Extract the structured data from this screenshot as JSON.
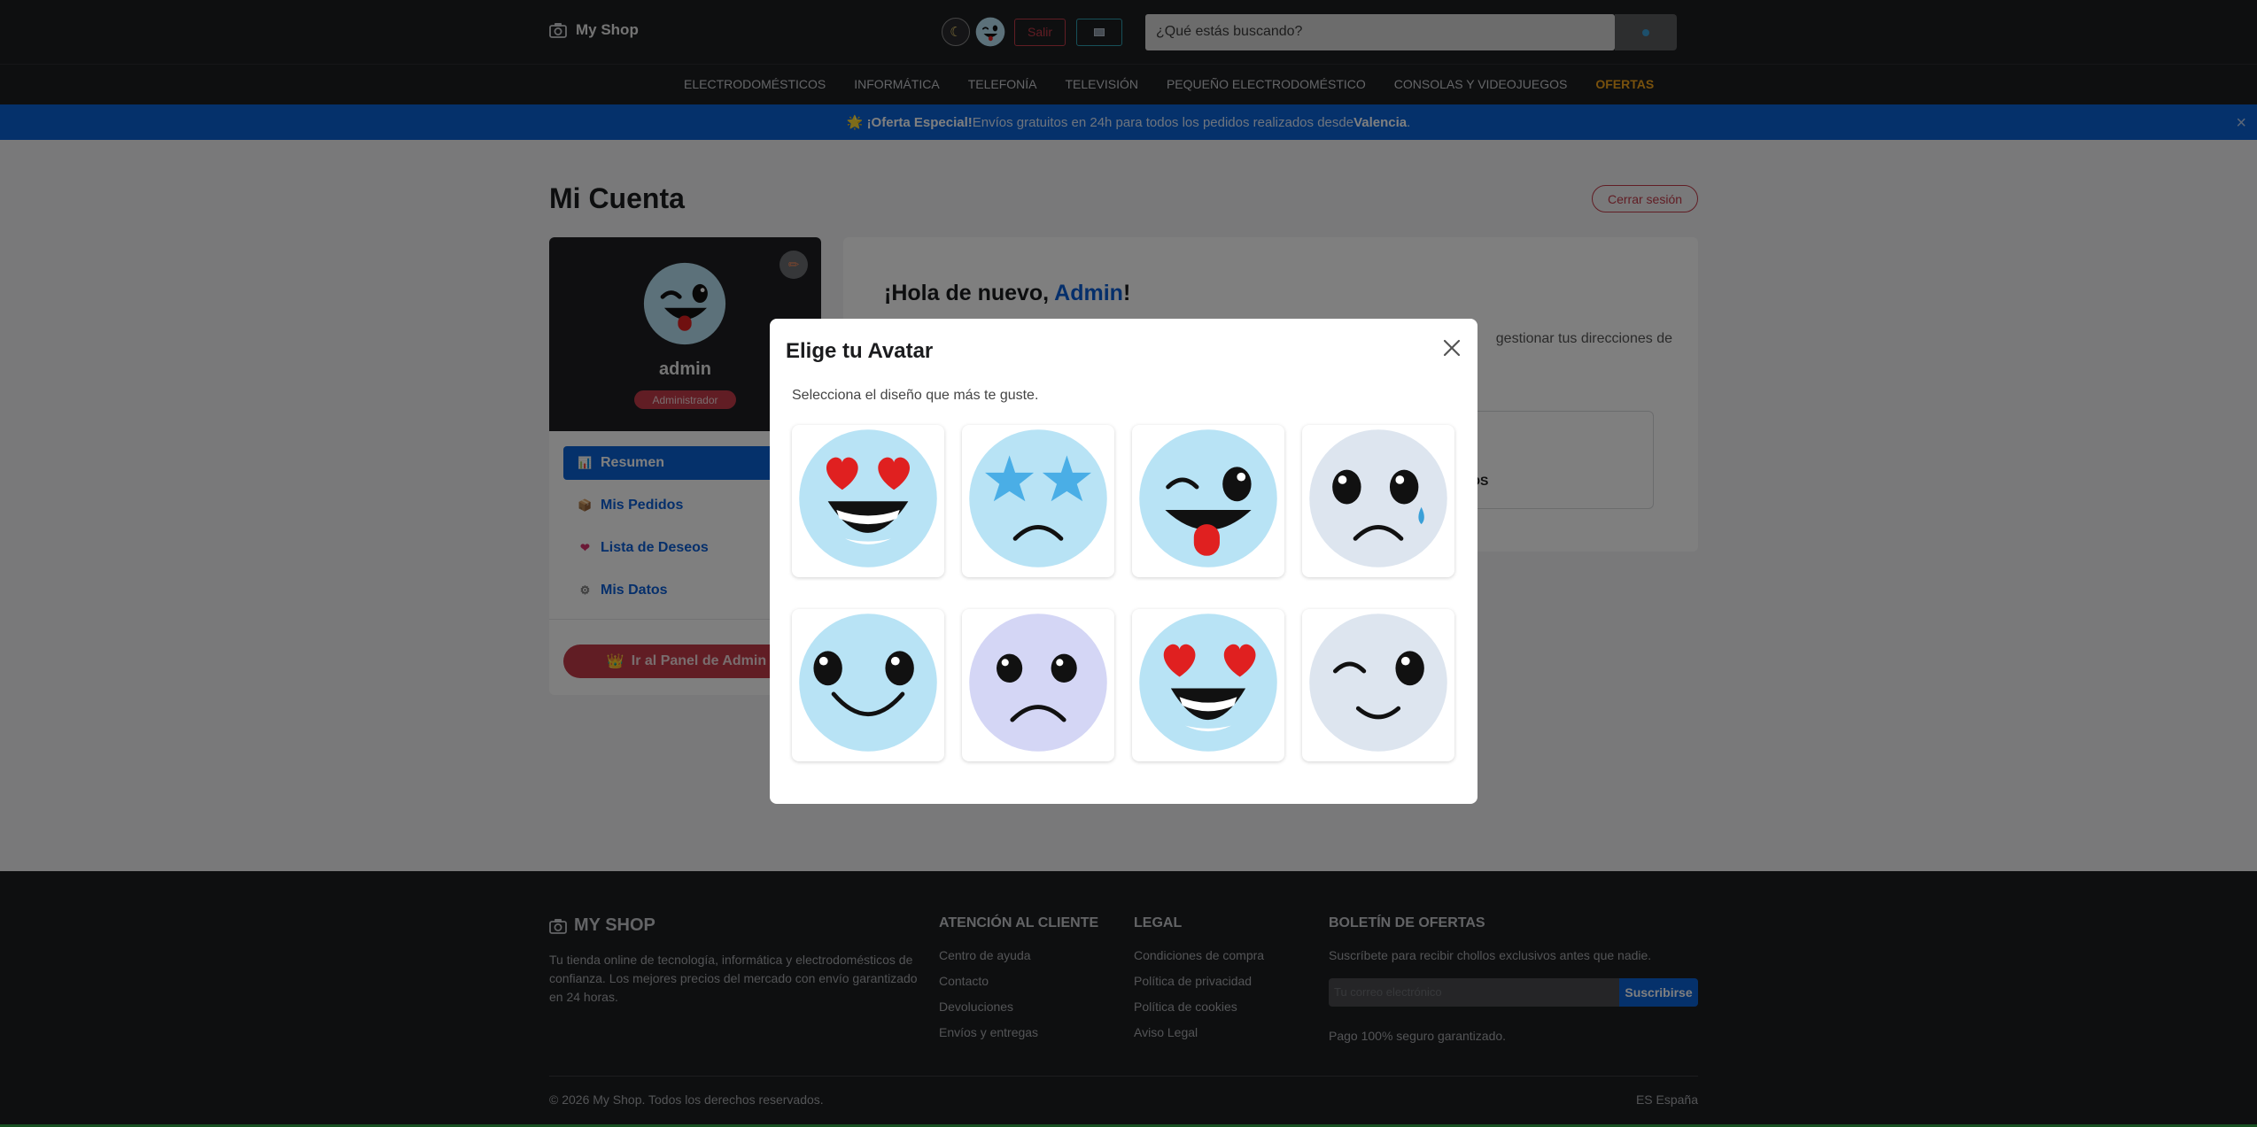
{
  "header": {
    "brand": "My Shop",
    "theme_icon": "☾",
    "logout_label": "Salir",
    "search_placeholder": "¿Qué estás buscando?"
  },
  "categories": [
    "ELECTRODOMÉSTICOS",
    "INFORMÁTICA",
    "TELEFONÍA",
    "TELEVISIÓN",
    "PEQUEÑO ELECTRODOMÉSTICO",
    "CONSOLAS Y VIDEOJUEGOS",
    "OFERTAS"
  ],
  "promo": {
    "icon": "🌟",
    "strong": "¡Oferta Especial!",
    "text": " Envíos gratuitos en 24h para todos los pedidos realizados desde ",
    "city": "Valencia",
    "end": ".",
    "close": "×"
  },
  "page": {
    "title": "Mi Cuenta",
    "logout_button": "Cerrar sesión"
  },
  "profile": {
    "username": "admin",
    "role": "Administrador",
    "edit_icon": "✏"
  },
  "menu": {
    "items": [
      {
        "icon": "📊",
        "label": "Resumen"
      },
      {
        "icon": "📦",
        "label": "Mis Pedidos"
      },
      {
        "icon": "❤",
        "label": "Lista de Deseos"
      },
      {
        "icon": "⚙",
        "label": "Mis Datos"
      }
    ],
    "admin_icon": "👑",
    "admin_button": "Ir al Panel de Admin"
  },
  "panel": {
    "greeting": "¡Hola de nuevo, ",
    "greeting_name": "Admin",
    "greeting_end": "!",
    "text_visible": "gestionar tus direcciones de",
    "card_label": "N DESEOS"
  },
  "modal": {
    "title": "Elige tu Avatar",
    "subtitle": "Selecciona el diseño que más te guste.",
    "avatars": [
      {
        "name": "heart-eyes-grin",
        "bg": "#b8e3f5"
      },
      {
        "name": "star-eyes-frown",
        "bg": "#b8e3f5"
      },
      {
        "name": "wink-tongue",
        "bg": "#b8e3f5"
      },
      {
        "name": "tear-frown",
        "bg": "#dde5ef"
      },
      {
        "name": "smile",
        "bg": "#b8e3f5"
      },
      {
        "name": "frown",
        "bg": "#d4d6f5"
      },
      {
        "name": "heart-eyes-grin",
        "bg": "#b8e3f5"
      },
      {
        "name": "wink-smile",
        "bg": "#dde5ef"
      }
    ]
  },
  "footer": {
    "brand": "MY SHOP",
    "description": "Tu tienda online de tecnología, informática y electrodomésticos de confianza. Los mejores precios del mercado con envío garantizado en 24 horas.",
    "support": {
      "title": "ATENCIÓN AL CLIENTE",
      "links": [
        "Centro de ayuda",
        "Contacto",
        "Devoluciones",
        "Envíos y entregas"
      ]
    },
    "legal": {
      "title": "LEGAL",
      "links": [
        "Condiciones de compra",
        "Política de privacidad",
        "Política de cookies",
        "Aviso Legal"
      ]
    },
    "newsletter": {
      "title": "BOLETÍN DE OFERTAS",
      "text": "Suscríbete para recibir chollos exclusivos antes que nadie.",
      "placeholder": "Tu correo electrónico",
      "button": "Suscribirse",
      "note": "Pago 100% seguro garantizado."
    },
    "copyright": "© 2026 My Shop. Todos los derechos reservados.",
    "language": "ES España"
  },
  "colors": {
    "primary": "#0b62d6",
    "danger": "#c23a48",
    "offer": "#f0a21a",
    "dark": "#1d1e21"
  }
}
